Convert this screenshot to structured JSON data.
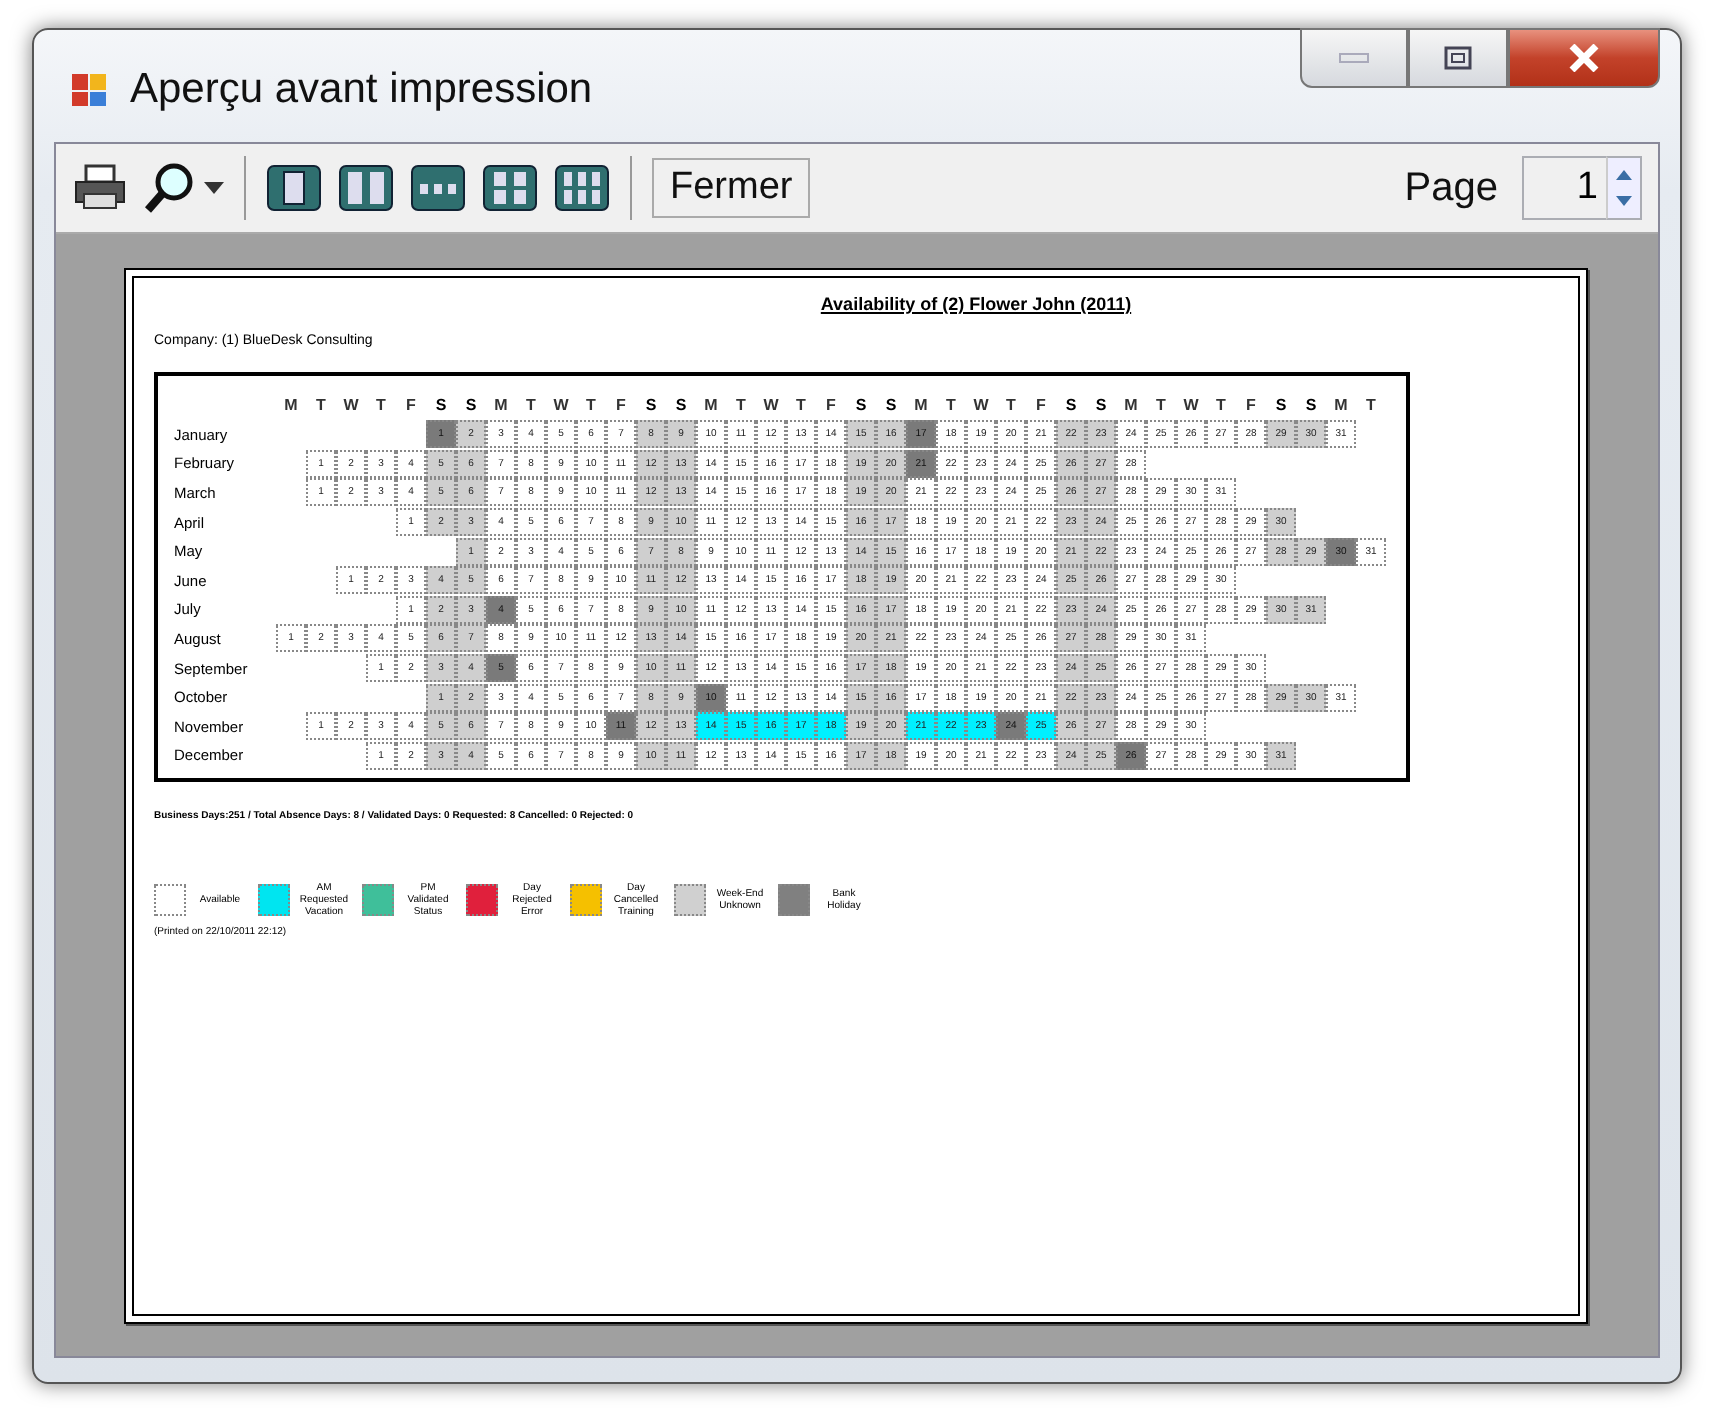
{
  "window": {
    "title": "Aperçu avant impression"
  },
  "toolbar": {
    "close_button": "Fermer",
    "page_label": "Page",
    "page_value": "1"
  },
  "document": {
    "title": "Availability of (2) Flower John (2011)",
    "company": "Company: (1) BlueDesk Consulting",
    "weekday_headers": [
      "M",
      "T",
      "W",
      "T",
      "F",
      "S",
      "S",
      "M",
      "T",
      "W",
      "T",
      "F",
      "S",
      "S",
      "M",
      "T",
      "W",
      "T",
      "F",
      "S",
      "S",
      "M",
      "T",
      "W",
      "T",
      "F",
      "S",
      "S",
      "M",
      "T",
      "W",
      "T",
      "F",
      "S",
      "S",
      "M",
      "T"
    ],
    "months": [
      {
        "name": "January",
        "days": [
          {
            "kind": "blank"
          },
          {
            "kind": "blank"
          },
          {
            "kind": "blank"
          },
          {
            "kind": "blank"
          },
          {
            "kind": "blank"
          },
          {
            "d": "1",
            "kind": "holiday"
          },
          "2",
          "3",
          "4",
          "5",
          "6",
          "7",
          "8",
          "9",
          "10",
          "11",
          "12",
          "13",
          "14",
          "15",
          "16",
          {
            "d": "17",
            "kind": "holiday"
          },
          "18",
          "19",
          "20",
          "21",
          "22",
          "23",
          "24",
          "25",
          "26",
          "27",
          "28",
          "29",
          "30",
          "31"
        ]
      },
      {
        "name": "February",
        "days": [
          {
            "kind": "blank"
          },
          "1",
          "2",
          "3",
          "4",
          "5",
          "6",
          "7",
          "8",
          "9",
          "10",
          "11",
          "12",
          "13",
          "14",
          "15",
          "16",
          "17",
          "18",
          "19",
          "20",
          {
            "d": "21",
            "kind": "holiday"
          },
          "22",
          "23",
          "24",
          "25",
          "26",
          "27",
          "28"
        ]
      },
      {
        "name": "March",
        "days": [
          {
            "kind": "blank"
          },
          "1",
          "2",
          "3",
          "4",
          "5",
          "6",
          "7",
          "8",
          "9",
          "10",
          "11",
          "12",
          "13",
          "14",
          "15",
          "16",
          "17",
          "18",
          "19",
          "20",
          "21",
          "22",
          "23",
          "24",
          "25",
          "26",
          "27",
          "28",
          "29",
          "30",
          "31"
        ]
      },
      {
        "name": "April",
        "days": [
          {
            "kind": "blank"
          },
          {
            "kind": "blank"
          },
          {
            "kind": "blank"
          },
          {
            "kind": "blank"
          },
          "1",
          "2",
          "3",
          "4",
          "5",
          "6",
          "7",
          "8",
          "9",
          "10",
          "11",
          "12",
          "13",
          "14",
          "15",
          "16",
          "17",
          "18",
          "19",
          "20",
          "21",
          "22",
          "23",
          "24",
          "25",
          "26",
          "27",
          "28",
          "29",
          "30"
        ]
      },
      {
        "name": "May",
        "days": [
          {
            "kind": "blank"
          },
          {
            "kind": "blank"
          },
          {
            "kind": "blank"
          },
          {
            "kind": "blank"
          },
          {
            "kind": "blank"
          },
          {
            "kind": "blank"
          },
          "1",
          "2",
          "3",
          "4",
          "5",
          "6",
          "7",
          "8",
          "9",
          "10",
          "11",
          "12",
          "13",
          "14",
          "15",
          "16",
          "17",
          "18",
          "19",
          "20",
          "21",
          "22",
          "23",
          "24",
          "25",
          "26",
          "27",
          "28",
          "29",
          {
            "d": "30",
            "kind": "holiday"
          },
          "31"
        ]
      },
      {
        "name": "June",
        "days": [
          {
            "kind": "blank"
          },
          {
            "kind": "blank"
          },
          "1",
          "2",
          "3",
          "4",
          "5",
          "6",
          "7",
          "8",
          "9",
          "10",
          "11",
          "12",
          "13",
          "14",
          "15",
          "16",
          "17",
          "18",
          "19",
          "20",
          "21",
          "22",
          "23",
          "24",
          "25",
          "26",
          "27",
          "28",
          "29",
          "30"
        ]
      },
      {
        "name": "July",
        "days": [
          {
            "kind": "blank"
          },
          {
            "kind": "blank"
          },
          {
            "kind": "blank"
          },
          {
            "kind": "blank"
          },
          "1",
          "2",
          "3",
          {
            "d": "4",
            "kind": "holiday"
          },
          "5",
          "6",
          "7",
          "8",
          "9",
          "10",
          "11",
          "12",
          "13",
          "14",
          "15",
          "16",
          "17",
          "18",
          "19",
          "20",
          "21",
          "22",
          "23",
          "24",
          "25",
          "26",
          "27",
          "28",
          "29",
          "30",
          "31"
        ]
      },
      {
        "name": "August",
        "days": [
          "1",
          "2",
          "3",
          "4",
          "5",
          "6",
          "7",
          "8",
          "9",
          "10",
          "11",
          "12",
          "13",
          "14",
          "15",
          "16",
          "17",
          "18",
          "19",
          "20",
          "21",
          "22",
          "23",
          "24",
          "25",
          "26",
          "27",
          "28",
          "29",
          "30",
          "31"
        ]
      },
      {
        "name": "September",
        "days": [
          {
            "kind": "blank"
          },
          {
            "kind": "blank"
          },
          {
            "kind": "blank"
          },
          "1",
          "2",
          "3",
          "4",
          {
            "d": "5",
            "kind": "holiday"
          },
          "6",
          "7",
          "8",
          "9",
          "10",
          "11",
          "12",
          "13",
          "14",
          "15",
          "16",
          "17",
          "18",
          "19",
          "20",
          "21",
          "22",
          "23",
          "24",
          "25",
          "26",
          "27",
          "28",
          "29",
          "30"
        ]
      },
      {
        "name": "October",
        "days": [
          {
            "kind": "blank"
          },
          {
            "kind": "blank"
          },
          {
            "kind": "blank"
          },
          {
            "kind": "blank"
          },
          {
            "kind": "blank"
          },
          "1",
          "2",
          "3",
          "4",
          "5",
          "6",
          "7",
          "8",
          "9",
          {
            "d": "10",
            "kind": "holiday"
          },
          "11",
          "12",
          "13",
          "14",
          "15",
          "16",
          "17",
          "18",
          "19",
          "20",
          "21",
          "22",
          "23",
          "24",
          "25",
          "26",
          "27",
          "28",
          "29",
          "30",
          "31"
        ]
      },
      {
        "name": "November",
        "days": [
          {
            "kind": "blank"
          },
          "1",
          "2",
          "3",
          "4",
          "5",
          "6",
          "7",
          "8",
          "9",
          "10",
          {
            "d": "11",
            "kind": "holiday"
          },
          "12",
          "13",
          {
            "d": "14",
            "kind": "requested"
          },
          {
            "d": "15",
            "kind": "requested"
          },
          {
            "d": "16",
            "kind": "requested"
          },
          {
            "d": "17",
            "kind": "requested"
          },
          {
            "d": "18",
            "kind": "requested"
          },
          "19",
          "20",
          {
            "d": "21",
            "kind": "requested"
          },
          {
            "d": "22",
            "kind": "requested"
          },
          {
            "d": "23",
            "kind": "requested"
          },
          {
            "d": "24",
            "kind": "holiday"
          },
          {
            "d": "25",
            "kind": "requested"
          },
          "26",
          "27",
          "28",
          "29",
          "30"
        ]
      },
      {
        "name": "December",
        "days": [
          {
            "kind": "blank"
          },
          {
            "kind": "blank"
          },
          {
            "kind": "blank"
          },
          "1",
          "2",
          "3",
          "4",
          "5",
          "6",
          "7",
          "8",
          "9",
          "10",
          "11",
          "12",
          "13",
          "14",
          "15",
          "16",
          "17",
          "18",
          "19",
          "20",
          "21",
          "22",
          "23",
          "24",
          "25",
          {
            "d": "26",
            "kind": "holiday"
          },
          "27",
          "28",
          "29",
          "30",
          "31"
        ]
      }
    ],
    "summary": "Business Days:251 / Total Absence Days: 8 / Validated Days: 0 Requested: 8 Cancelled: 0 Rejected: 0",
    "legend": [
      {
        "label": "Available",
        "color": "#ffffff"
      },
      {
        "label": "AM Requested Vacation",
        "color": "#00e5f0"
      },
      {
        "label": "PM Validated Status",
        "color": "#3fbf9a"
      },
      {
        "label": "Day Rejected Error",
        "color": "#e0203c"
      },
      {
        "label": "Day Cancelled Training",
        "color": "#f5c000"
      },
      {
        "label": "Week-End Unknown",
        "color": "#d0d0d0"
      },
      {
        "label": "Bank Holiday",
        "color": "#808080"
      }
    ],
    "printed_on": "(Printed on 22/10/2011 22:12)"
  }
}
